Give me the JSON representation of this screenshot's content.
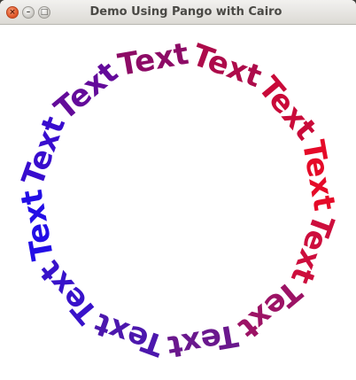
{
  "window": {
    "title": "Demo Using Pango with Cairo",
    "close_glyph": "×",
    "minimize_glyph": "–",
    "maximize_glyph": "□"
  },
  "canvas": {
    "words": [
      "Text",
      "Text",
      "Text",
      "Text",
      "Text",
      "Text",
      "Text",
      "Text",
      "Text",
      "Text",
      "Text",
      "Text"
    ],
    "colors": {
      "top": "#9b0b55",
      "right": "#ee0a22",
      "bottom": "#5a1a9a",
      "left": "#1c0cf0"
    }
  }
}
